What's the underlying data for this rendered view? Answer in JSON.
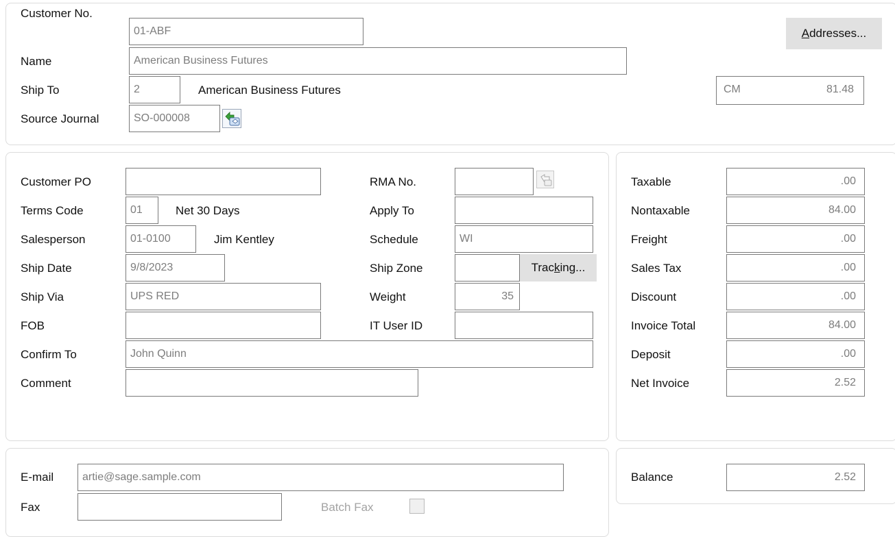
{
  "header": {
    "customer_no_label": "Customer No.",
    "customer_no": "01-ABF",
    "name_label": "Name",
    "name": "American Business Futures",
    "ship_to_label": "Ship To",
    "ship_to_code": "2",
    "ship_to_name": "American Business Futures",
    "source_journal_label": "Source Journal",
    "source_journal": "SO-000008",
    "addresses_button": {
      "pre": "",
      "mnemonic": "A",
      "post": "ddresses..."
    },
    "cm_label": "CM",
    "cm_amount": "81.48"
  },
  "details": {
    "customer_po_label": "Customer PO",
    "customer_po": "",
    "terms_code_label": "Terms Code",
    "terms_code": "01",
    "terms_desc": "Net 30 Days",
    "salesperson_label": "Salesperson",
    "salesperson_code": "01-0100",
    "salesperson_name": "Jim Kentley",
    "ship_date_label": "Ship Date",
    "ship_date": "9/8/2023",
    "ship_via_label": "Ship Via",
    "ship_via": "UPS RED",
    "fob_label": "FOB",
    "fob": "",
    "confirm_to_label": "Confirm To",
    "confirm_to": "John Quinn",
    "comment_label": "Comment",
    "comment": "",
    "rma_no_label": "RMA No.",
    "rma_no": "",
    "apply_to_label": "Apply To",
    "apply_to": "",
    "schedule_label": "Schedule",
    "schedule": "WI",
    "ship_zone_label": "Ship Zone",
    "ship_zone": "",
    "tracking_button": {
      "pre": "Trac",
      "mnemonic": "k",
      "post": "ing..."
    },
    "weight_label": "Weight",
    "weight": "35",
    "it_user_id_label": "IT User ID",
    "it_user_id": ""
  },
  "totals": {
    "taxable_label": "Taxable",
    "taxable": ".00",
    "nontaxable_label": "Nontaxable",
    "nontaxable": "84.00",
    "freight_label": "Freight",
    "freight": ".00",
    "sales_tax_label": "Sales Tax",
    "sales_tax": ".00",
    "discount_label": "Discount",
    "discount": ".00",
    "invoice_total_label": "Invoice Total",
    "invoice_total": "84.00",
    "deposit_label": "Deposit",
    "deposit": ".00",
    "net_invoice_label": "Net Invoice",
    "net_invoice": "2.52"
  },
  "contact": {
    "email_label": "E-mail",
    "email": "artie@sage.sample.com",
    "fax_label": "Fax",
    "fax": "",
    "batch_fax_label": "Batch Fax",
    "batch_fax_checked": false
  },
  "balance": {
    "label": "Balance",
    "value": "2.52"
  },
  "icons": {
    "source_journal_lookup": "drill-down-lookup-icon",
    "rma_lookup": "lookup-icon"
  }
}
